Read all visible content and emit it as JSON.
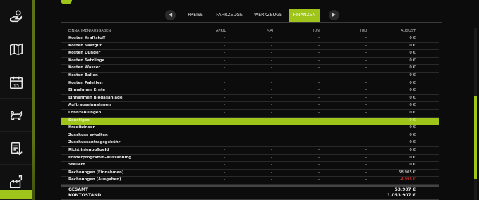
{
  "tabs": {
    "prev_arrow": "◀",
    "next_arrow": "▶",
    "items": [
      {
        "label": "PREISE"
      },
      {
        "label": "FAHRZEUGE"
      },
      {
        "label": "WERKZEUGE"
      },
      {
        "label": "FINANZEN"
      }
    ],
    "active": "FINANZEN"
  },
  "sidebar": {
    "icons": [
      "money-hand-icon",
      "map-icon",
      "calendar-icon",
      "animals-icon",
      "contracts-icon",
      "production-icon",
      "finance-icon"
    ],
    "calendar_day": "15"
  },
  "table": {
    "header": {
      "label": "EINNAHMEN/AUSGABEN",
      "months": [
        "APRIL",
        "MAI",
        "JUNI",
        "JULI",
        "AUGUST"
      ]
    },
    "rows": [
      {
        "label": "Kosten Kraftstoff",
        "values": [
          "-",
          "-",
          "-",
          "-",
          "0 €"
        ]
      },
      {
        "label": "Kosten Saatgut",
        "values": [
          "-",
          "-",
          "-",
          "-",
          "0 €"
        ]
      },
      {
        "label": "Kosten Dünger",
        "values": [
          "-",
          "-",
          "-",
          "-",
          "0 €"
        ]
      },
      {
        "label": "Kosten Setzlinge",
        "values": [
          "-",
          "-",
          "-",
          "-",
          "0 €"
        ]
      },
      {
        "label": "Kosten Wasser",
        "values": [
          "-",
          "-",
          "-",
          "-",
          "0 €"
        ]
      },
      {
        "label": "Kosten Ballen",
        "values": [
          "-",
          "-",
          "-",
          "-",
          "0 €"
        ]
      },
      {
        "label": "Kosten Paletten",
        "values": [
          "-",
          "-",
          "-",
          "-",
          "0 €"
        ]
      },
      {
        "label": "Einnahmen Ernte",
        "values": [
          "-",
          "-",
          "-",
          "-",
          "0 €"
        ]
      },
      {
        "label": "Einnahmen Biogasanlage",
        "values": [
          "-",
          "-",
          "-",
          "-",
          "0 €"
        ]
      },
      {
        "label": "Auftragseinnahmen",
        "values": [
          "-",
          "-",
          "-",
          "-",
          "0 €"
        ]
      },
      {
        "label": "Lohnzahlungen",
        "values": [
          "-",
          "-",
          "-",
          "-",
          "0 €"
        ]
      },
      {
        "label": "Sonstiges",
        "values": [
          "-",
          "-",
          "-",
          "-",
          "0 €"
        ]
      },
      {
        "label": "Kreditzinsen",
        "values": [
          "-",
          "-",
          "-",
          "-",
          "0 €"
        ]
      },
      {
        "label": "Zuschuss erhalten",
        "values": [
          "-",
          "-",
          "-",
          "-",
          "0 €"
        ]
      },
      {
        "label": "Zuschussantragsgebühr",
        "values": [
          "-",
          "-",
          "-",
          "-",
          "0 €"
        ]
      },
      {
        "label": "Richtlinienbußgeld",
        "values": [
          "-",
          "-",
          "-",
          "-",
          "0 €"
        ]
      },
      {
        "label": "Förderprogramm-Auszahlung",
        "values": [
          "-",
          "-",
          "-",
          "-",
          "0 €"
        ]
      },
      {
        "label": "Steuern",
        "values": [
          "-",
          "-",
          "-",
          "-",
          "0 €"
        ]
      },
      {
        "label": "Rechnungen (Einnahmen)",
        "values": [
          "-",
          "-",
          "-",
          "-",
          "58.905 €"
        ]
      },
      {
        "label": "Rechnungen (Ausgaben)",
        "values": [
          "-",
          "-",
          "-",
          "-",
          "-4.998 €"
        ]
      }
    ],
    "highlight_row": 11,
    "negative_row": 19,
    "gesamt": {
      "label": "GESAMT",
      "value": "53.907 €"
    },
    "kontostand": {
      "label": "KONTOSTAND",
      "value": "1.053.907 €"
    }
  },
  "colors": {
    "accent": "#9fc51a",
    "negative": "#e53935",
    "background": "#0c0c0c"
  }
}
